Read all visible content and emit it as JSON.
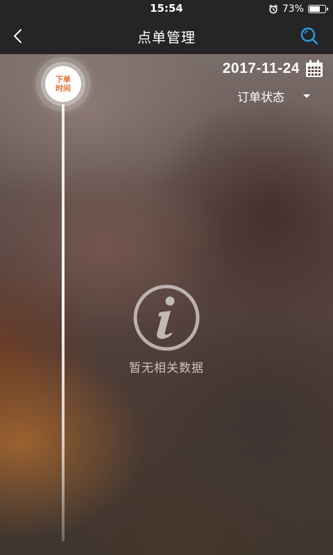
{
  "status_bar": {
    "time": "15:54",
    "battery_percent": "73%",
    "battery_level": 0.73,
    "alarm_icon": "alarm-clock-icon"
  },
  "nav": {
    "title": "点单管理",
    "back_icon": "chevron-left-icon",
    "search_icon": "search-icon"
  },
  "timeline": {
    "node_line1": "下单",
    "node_line2": "时间"
  },
  "date_picker": {
    "date": "2017-11-24",
    "icon": "calendar-icon"
  },
  "filter": {
    "label": "订单状态",
    "icon": "caret-down-icon"
  },
  "empty_state": {
    "icon": "info-icon",
    "message": "暂无相关数据"
  },
  "colors": {
    "nav_background": "#252527",
    "search_icon": "#2a9be0",
    "timeline_accent": "#e06a2a"
  }
}
